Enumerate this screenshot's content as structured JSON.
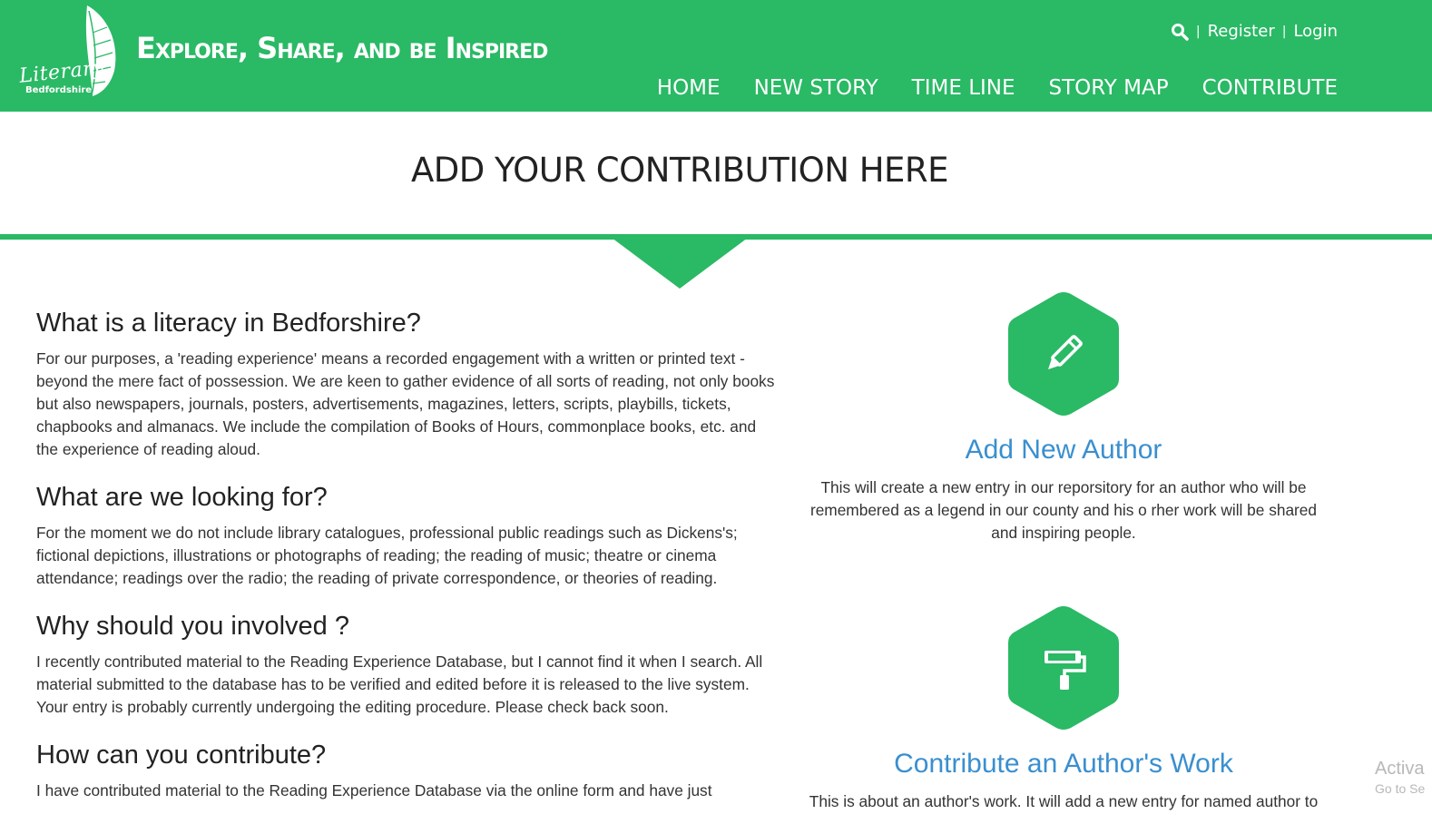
{
  "header": {
    "logo_word": "Literary",
    "logo_sub": "Bedfordshire",
    "tagline": "Explore, Share, and be Inspired",
    "top_links": {
      "search_icon": "search-icon",
      "separator": "|",
      "register": "Register",
      "login": "Login"
    },
    "nav": [
      "HOME",
      "NEW STORY",
      "TIME LINE",
      "STORY MAP",
      "CONTRIBUTE"
    ]
  },
  "page_title": "ADD YOUR CONTRIBUTION HERE",
  "faq": [
    {
      "heading": "What is a literacy in Bedforshire?",
      "body": "For our purposes, a 'reading experience' means a recorded engagement with a written or printed text - beyond the mere fact of possession. We are keen to gather evidence of all sorts of reading, not only books but also newspapers, journals, posters, advertisements, magazines, letters, scripts, playbills, tickets, chapbooks and almanacs. We include the compilation of Books of Hours, commonplace books, etc. and the experience of reading aloud."
    },
    {
      "heading": "What are we looking for?",
      "body": "For the moment we do not include library catalogues, professional public readings such as Dickens's; fictional depictions, illustrations or photographs of reading; the reading of music; theatre or cinema attendance; readings over the radio; the reading of private correspondence, or theories of reading."
    },
    {
      "heading": "Why should you involved ?",
      "body": "I recently contributed material to the Reading Experience Database, but I cannot find it when I search. All material submitted to the database has to be verified and edited before it is released to the live system. Your entry is probably currently undergoing the editing procedure. Please check back soon."
    },
    {
      "heading": "How can you contribute?",
      "body": "I have contributed material to the Reading Experience Database via the online form and have just"
    }
  ],
  "cards": [
    {
      "icon": "pencil-icon",
      "title": "Add New Author",
      "body": "This will create a new entry in our reporsitory for an author who will be remembered as a legend in our county and his o rher work will be shared and inspiring people."
    },
    {
      "icon": "paint-roller-icon",
      "title": "Contribute an Author's Work",
      "body": "This is about an author's work. It will add a new entry for named author to"
    }
  ],
  "watermark": {
    "line1": "Activa",
    "line2": "Go to Se"
  },
  "colors": {
    "brand_green": "#2ab965",
    "link_blue": "#3a8fcf",
    "text_dark": "#333333"
  }
}
